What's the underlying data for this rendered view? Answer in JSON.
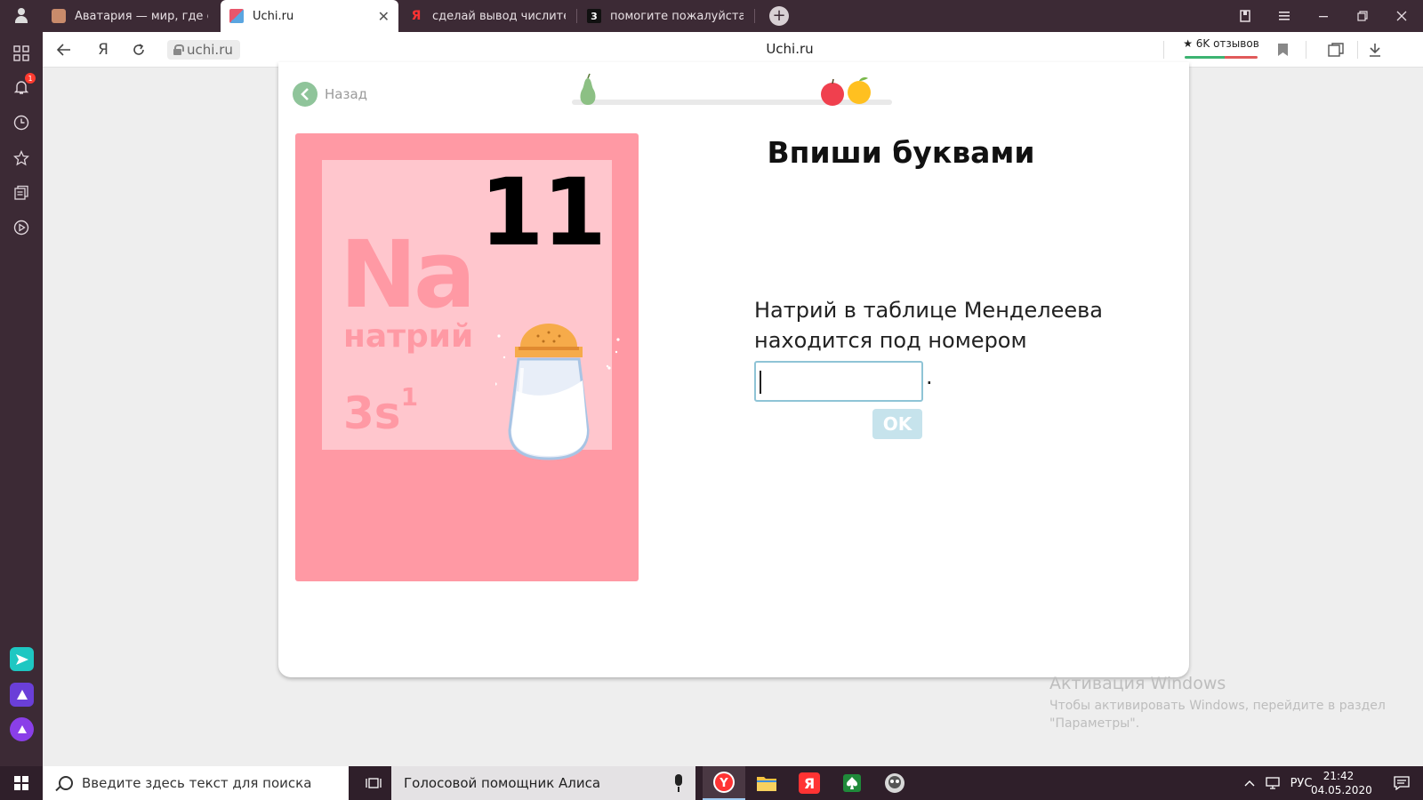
{
  "browser": {
    "tabs": [
      {
        "title": "Аватария — мир, где сбываются мечты",
        "active": false
      },
      {
        "title": "Uchi.ru",
        "active": true
      },
      {
        "title": "сделай вывод числительные",
        "active": false
      },
      {
        "title": "помогите пожалуйста по",
        "active": false
      }
    ],
    "tab3_favicon": "Я",
    "tab4_favicon": "3",
    "close_glyph": "✕",
    "new_tab_glyph": "+",
    "url": "uchi.ru",
    "page_title": "Uchi.ru",
    "reviews_label": "★ 6K отзывов",
    "yandex_glyph": "Я",
    "sidebar_badge": "1"
  },
  "lesson": {
    "back_label": "Назад",
    "heading": "Впиши буквами",
    "question_line1": "Натрий в таблице Менделеева",
    "question_line2": "находится под номером",
    "answer_value": "",
    "answer_suffix": ".",
    "ok_label": "OK",
    "element": {
      "number": "11",
      "symbol": "Na",
      "name": "натрий",
      "config_base": "3s",
      "config_sup": "1"
    }
  },
  "watermark": {
    "title": "Активация Windows",
    "line1": "Чтобы активировать Windows, перейдите в раздел",
    "line2": "\"Параметры\"."
  },
  "taskbar": {
    "search_placeholder": "Введите здесь текст для поиска",
    "alice_label": "Голосовой помощник Алиса",
    "language": "РУС",
    "time": "21:42",
    "date": "04.05.2020"
  },
  "colors": {
    "card_pink": "#ff99a4",
    "inner_pink": "#ffc6cd",
    "browser_chrome": "#3c2a35",
    "ok_button": "#c6e3ec",
    "back_button": "#8fc49a"
  }
}
